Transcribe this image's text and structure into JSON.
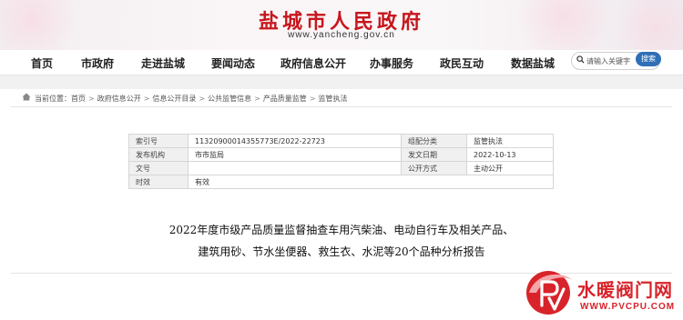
{
  "header": {
    "title": "盐城市人民政府",
    "url": "www.yancheng.gov.cn"
  },
  "nav": {
    "items": [
      "首页",
      "市政府",
      "走进盐城",
      "要闻动态",
      "政府信息公开",
      "办事服务",
      "政民互动",
      "数据盐城"
    ]
  },
  "search": {
    "placeholder": "请输入关键字",
    "button_label": "搜索"
  },
  "breadcrumb": {
    "prefix": "当前位置：",
    "items": [
      "首页",
      "政府信息公开",
      "信息公开目录",
      "公共监管信息",
      "产品质量监管",
      "监管执法"
    ],
    "separator": ">"
  },
  "info_table": {
    "rows": [
      {
        "label": "索引号",
        "value": "11320900014355773E/2022-22723",
        "label2": "组配分类",
        "value2": "监管执法"
      },
      {
        "label": "发布机构",
        "value": "市市监局",
        "label2": "发文日期",
        "value2": "2022-10-13"
      },
      {
        "label": "文号",
        "value": "",
        "label2": "公开方式",
        "value2": "主动公开"
      },
      {
        "label": "时效",
        "value": "有效"
      }
    ]
  },
  "document": {
    "title_line1": "2022年度市级产品质量监督抽查车用汽柴油、电动自行车及相关产品、",
    "title_line2": "建筑用砂、节水坐便器、救生衣、水泥等20个品种分析报告"
  },
  "watermark": {
    "brand": "水暖阀门网",
    "url": "WWW.PVCPU.COM",
    "logo_letters": "PV",
    "color": "#d8232a"
  },
  "colors": {
    "title_red": "#c8161d",
    "search_blue": "#2f6fb5",
    "label_bg": "#f0f0f0"
  }
}
